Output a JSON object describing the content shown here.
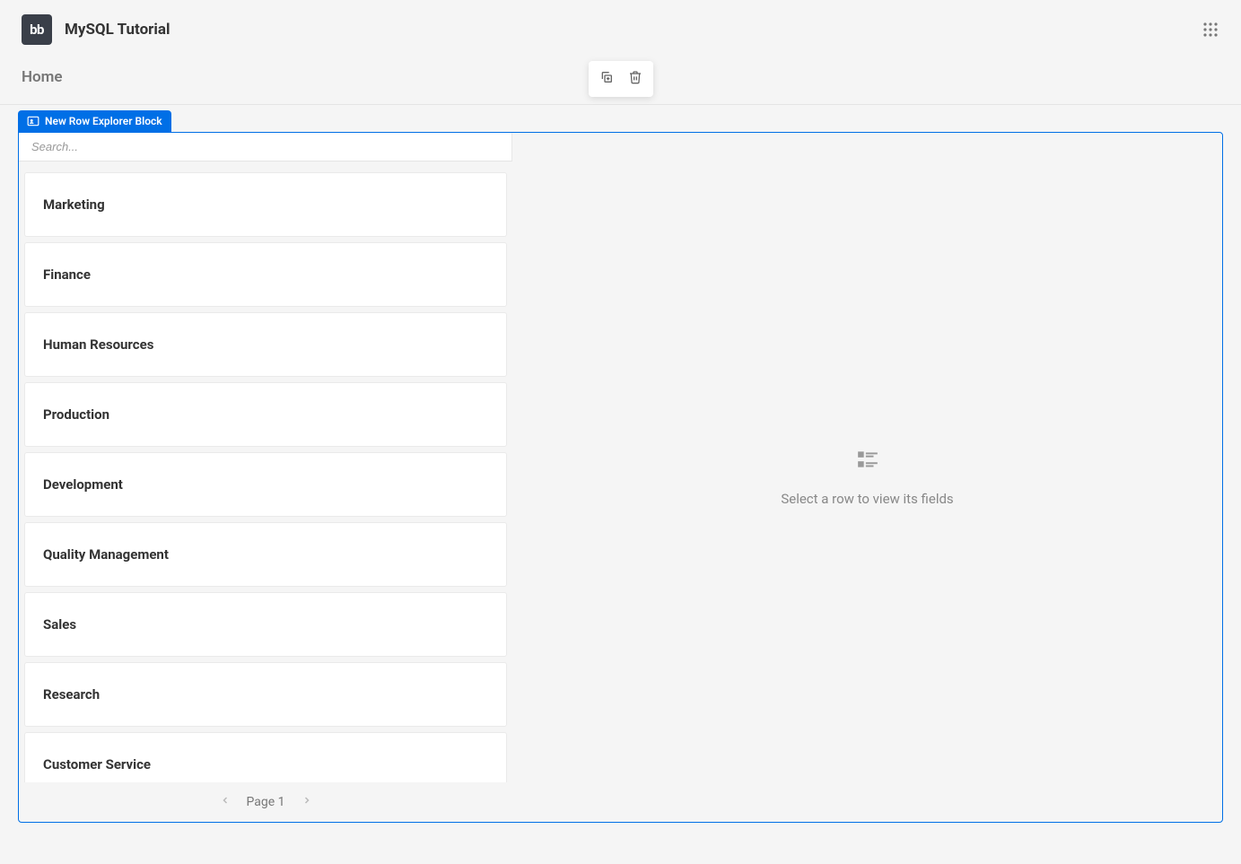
{
  "header": {
    "logo_text": "bb",
    "app_title": "MySQL Tutorial"
  },
  "breadcrumb": {
    "home": "Home"
  },
  "block": {
    "tab_label": "New Row Explorer Block",
    "search_placeholder": "Search...",
    "rows": [
      {
        "label": "Marketing"
      },
      {
        "label": "Finance"
      },
      {
        "label": "Human Resources"
      },
      {
        "label": "Production"
      },
      {
        "label": "Development"
      },
      {
        "label": "Quality Management"
      },
      {
        "label": "Sales"
      },
      {
        "label": "Research"
      },
      {
        "label": "Customer Service"
      }
    ],
    "pager": {
      "label": "Page 1"
    },
    "empty_state": {
      "text": "Select a row to view its fields"
    }
  }
}
